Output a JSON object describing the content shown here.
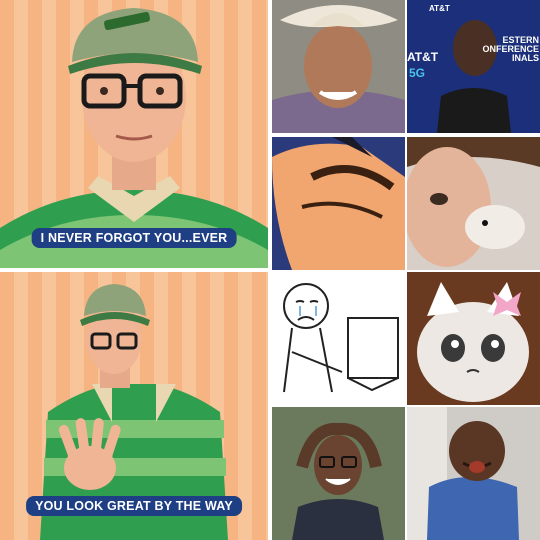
{
  "captions": {
    "top": "I NEVER FORGOT YOU...EVER",
    "bottom": "YOU LOOK GREAT BY THE WAY"
  },
  "tile_text": {
    "att_logo_small": "AT&T",
    "att_logo_big": "AT&T",
    "att_5g": "5G",
    "att_banner": "ESTERN\nONFERENCE\nINALS"
  },
  "colors": {
    "caption_bg": "#1f3f84",
    "stripe_a": "#f6b483",
    "stripe_b": "#f8c59a",
    "shirt_green_dark": "#2f9e4f",
    "shirt_green_light": "#7dc474",
    "att_blue": "#1b2f7a"
  },
  "icons": [
    "pointing-hand-icon",
    "hat-icon",
    "glasses-icon"
  ]
}
